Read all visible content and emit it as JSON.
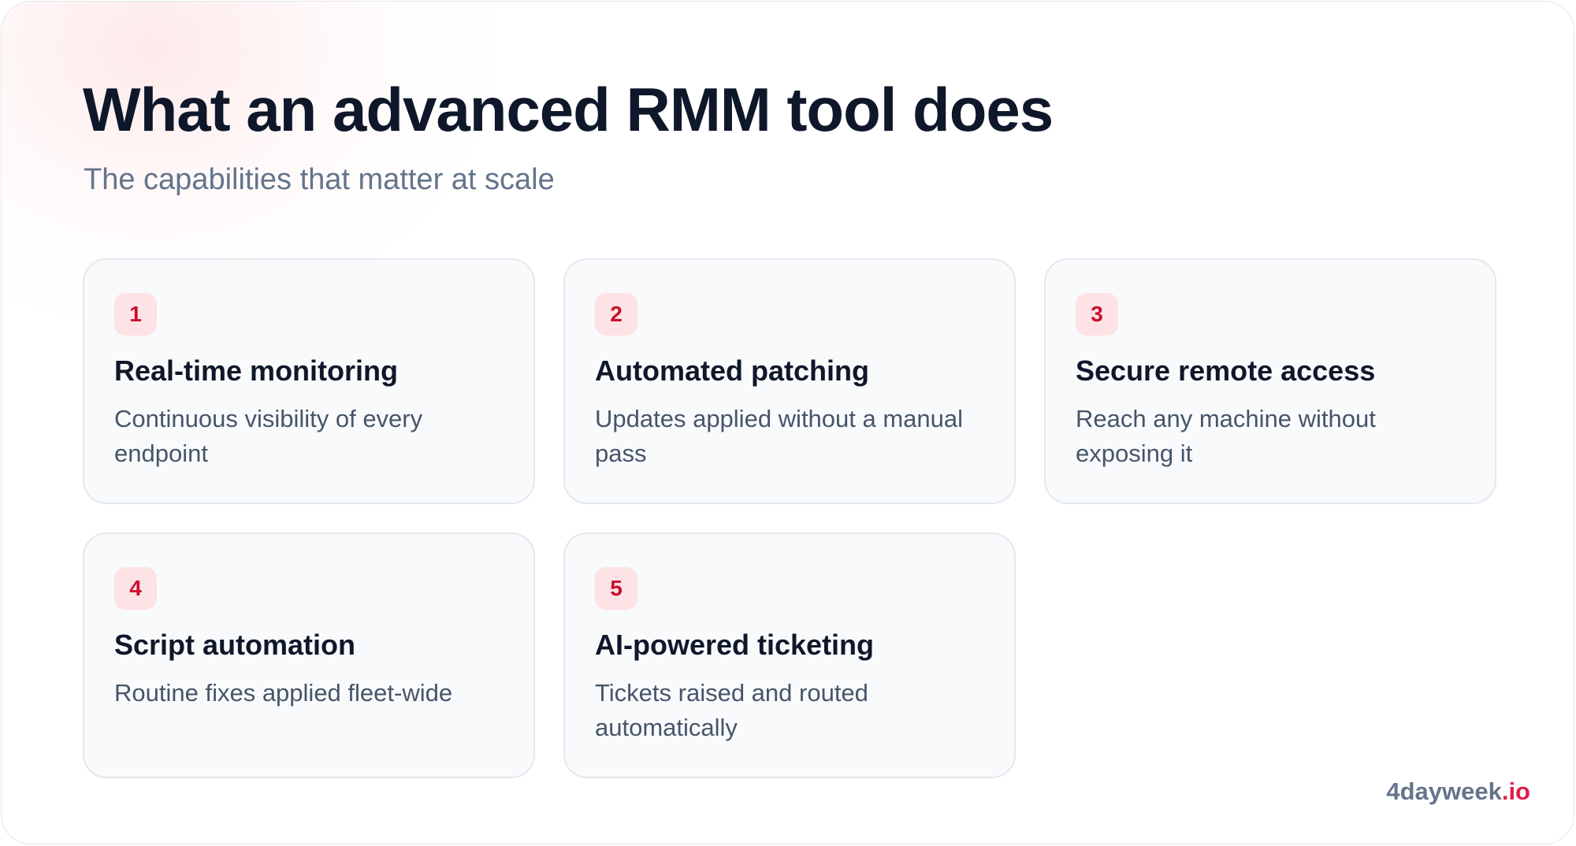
{
  "header": {
    "title": "What an advanced RMM tool does",
    "subtitle": "The capabilities that matter at scale"
  },
  "cards": [
    {
      "number": "1",
      "title": "Real-time monitoring",
      "description": "Continuous visibility of every endpoint"
    },
    {
      "number": "2",
      "title": "Automated patching",
      "description": "Updates applied without a manual pass"
    },
    {
      "number": "3",
      "title": "Secure remote access",
      "description": "Reach any machine without exposing it"
    },
    {
      "number": "4",
      "title": "Script automation",
      "description": "Routine fixes applied fleet-wide"
    },
    {
      "number": "5",
      "title": "AI-powered ticketing",
      "description": "Tickets raised and routed automatically"
    }
  ],
  "brand": {
    "name": "4dayweek",
    "suffix": ".io"
  },
  "colors": {
    "title": "#0f172a",
    "subtitle": "#64748b",
    "accent": "#e11d48",
    "badge_bg": "#fde2e6",
    "card_bg": "#f8fafc"
  }
}
